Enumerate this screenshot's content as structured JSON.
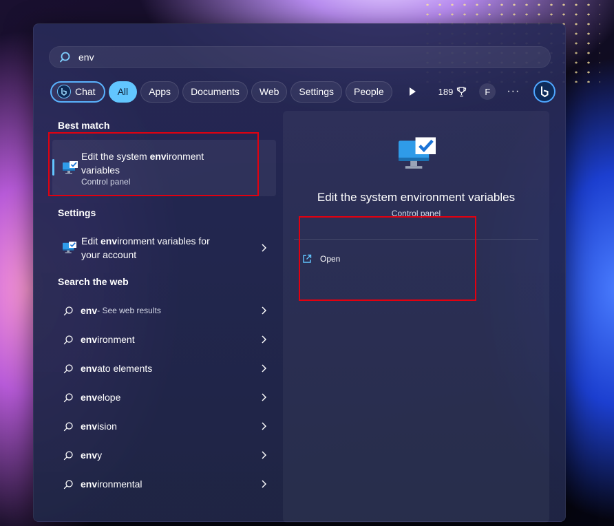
{
  "search": {
    "query": "env"
  },
  "filters": {
    "chat": "Chat",
    "all": "All",
    "apps": "Apps",
    "documents": "Documents",
    "web": "Web",
    "settings": "Settings",
    "people": "People",
    "reward_count": "189",
    "profile_initial": "F",
    "more": "···"
  },
  "sections": {
    "best_match": "Best match",
    "settings": "Settings",
    "search_web": "Search the web"
  },
  "best_match": {
    "title_pre": "Edit the system ",
    "title_bold": "env",
    "title_post": "ironment variables",
    "subtitle": "Control panel"
  },
  "settings_result": {
    "pre": "Edit ",
    "bold": "env",
    "post": "ironment variables for your account"
  },
  "web_results": [
    {
      "bold": "env",
      "rest": "",
      "hint": " - See web results"
    },
    {
      "bold": "env",
      "rest": "ironment",
      "hint": ""
    },
    {
      "bold": "env",
      "rest": "ato elements",
      "hint": ""
    },
    {
      "bold": "env",
      "rest": "elope",
      "hint": ""
    },
    {
      "bold": "env",
      "rest": "ision",
      "hint": ""
    },
    {
      "bold": "env",
      "rest": "y",
      "hint": ""
    },
    {
      "bold": "env",
      "rest": "ironmental",
      "hint": ""
    }
  ],
  "detail": {
    "title": "Edit the system environment variables",
    "subtitle": "Control panel",
    "open_label": "Open"
  },
  "colors": {
    "accent": "#62c6ff",
    "highlight_box": "#e3000f"
  }
}
